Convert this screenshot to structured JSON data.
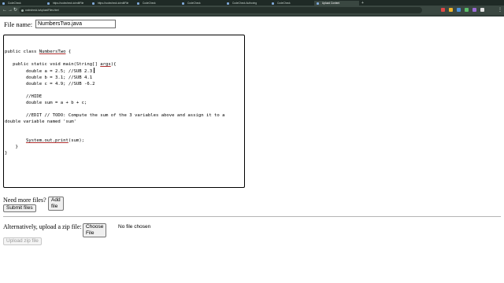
{
  "browser": {
    "tabs": [
      {
        "label": "CodeCheck",
        "active": false
      },
      {
        "label": "https://codecheck.io/editFile",
        "active": false
      },
      {
        "label": "https://codecheck.io/editFile",
        "active": false
      },
      {
        "label": "CodeCheck",
        "active": false
      },
      {
        "label": "CodeCheck",
        "active": false
      },
      {
        "label": "CodeCheck Authoring",
        "active": false
      },
      {
        "label": "CodeCheck",
        "active": false
      },
      {
        "label": "Upload Content",
        "active": true
      }
    ],
    "new_tab_symbol": "+",
    "back_symbol": "←",
    "forward_symbol": "→",
    "reload_symbol": "↻",
    "url": "codecheck.io/uploadFiles.html",
    "menu_symbol": "⋮",
    "extension_colors": [
      "#e04848",
      "#f0b429",
      "#4a90d9",
      "#5bbf6a",
      "#9b6bd6",
      "#e0e0e0"
    ]
  },
  "form": {
    "file_name_label": "File name:",
    "file_name_value": "NumbersTwo.java",
    "code_lines": [
      "",
      "public class NumbersTwo {",
      "",
      "   public static void main(String[] args){",
      "        double a = 2.5; //SUB 2.3",
      "        double b = 3.1; //SUB 4.1",
      "        double c = 4.9; //SUB -6.2",
      "",
      "        //HIDE",
      "        double sum = a + b + c;",
      "",
      "        //EDIT // TODO: Compute the sum of the 3 variables above and assign it to a",
      "double variable named 'sum'",
      "",
      "",
      "        System.out.print(sum);",
      "    }",
      "}"
    ],
    "need_more_label": "Need more files?",
    "add_file_button": "Add file",
    "submit_button": "Submit files",
    "zip_label": "Alternatively, upload a zip file:",
    "choose_file_button": "Choose File",
    "no_file_text": "No file chosen",
    "upload_zip_button": "Upload zip file"
  }
}
